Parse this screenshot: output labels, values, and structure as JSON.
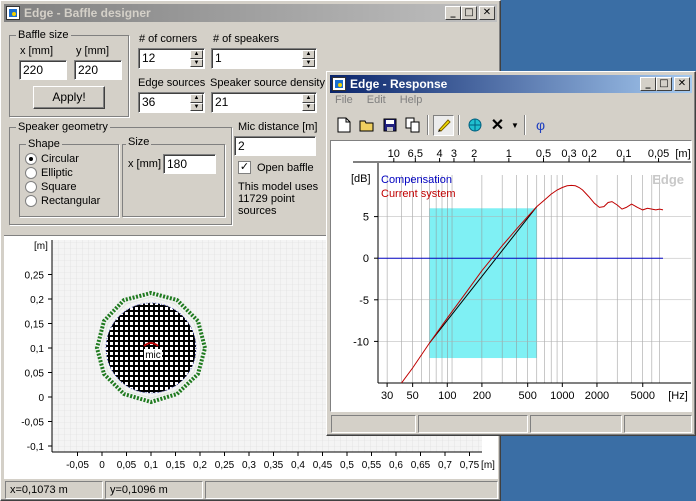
{
  "baffle_window": {
    "title": "Edge - Baffle designer",
    "baffle_size": {
      "label": "Baffle size",
      "x_label": "x [mm]",
      "y_label": "y [mm]",
      "x_value": "220",
      "y_value": "220",
      "apply_label": "Apply!"
    },
    "corners": {
      "label": "# of corners",
      "value": "12"
    },
    "speakers": {
      "label": "# of speakers",
      "value": "1"
    },
    "edge_sources": {
      "label": "Edge sources",
      "value": "36"
    },
    "density": {
      "label": "Speaker source density",
      "value": "21"
    },
    "geometry": {
      "label": "Speaker geometry",
      "shape_label": "Shape",
      "shapes": [
        "Circular",
        "Elliptic",
        "Square",
        "Rectangular"
      ],
      "selected": "Circular",
      "size_label": "Size",
      "size_x_label": "x [mm]",
      "size_x_value": "180"
    },
    "mic": {
      "label": "Mic distance [m]",
      "value": "2"
    },
    "open_baffle": {
      "label": "Open baffle",
      "checked": true
    },
    "model_info": "This model uses 11729 point sources",
    "plot": {
      "unit": "[m]",
      "y_ticks": [
        "0,25",
        "0,2",
        "0,15",
        "0,1",
        "0,05",
        "0",
        "-0,05",
        "-0,1"
      ],
      "x_ticks": [
        "-0,05",
        "0",
        "0,05",
        "0,1",
        "0,15",
        "0,2",
        "0,25",
        "0,3",
        "0,35",
        "0,4",
        "0,45",
        "0,5",
        "0,55",
        "0,6",
        "0,65",
        "0,7",
        "0,75"
      ],
      "mic_label": "mic"
    },
    "status": {
      "x": "x=0,1073 m",
      "y": "y=0,1096 m"
    }
  },
  "response_window": {
    "title": "Edge - Response",
    "menu": [
      "File",
      "Edit",
      "Help"
    ],
    "toolbar": [
      "new-icon",
      "open-icon",
      "save-icon",
      "copy-icon",
      "pen-icon",
      "globe-icon",
      "delete-icon",
      "dropdown-icon",
      "phi-icon"
    ],
    "phi_symbol": "φ",
    "chart_data": {
      "type": "line",
      "title": "",
      "ylabel": "[dB]",
      "xlabel": "[Hz]",
      "top_axis_label": "[m]",
      "watermark": "Edge",
      "ylim": [
        -15,
        10
      ],
      "xlim": [
        25,
        7500
      ],
      "x_scale": "log",
      "y_ticks": [
        "5",
        "0",
        "-5",
        "-10"
      ],
      "x_ticks": [
        "30",
        "50",
        "100",
        "200",
        "500",
        "1000",
        "2000",
        "5000"
      ],
      "top_ticks": [
        "10",
        "6,5",
        "4",
        "3",
        "2",
        "1",
        "0,5",
        "0,3",
        "0,2",
        "0,1",
        "0,05"
      ],
      "legend": [
        "Compensation",
        "Current system"
      ],
      "highlight": {
        "x": [
          70,
          600
        ],
        "y": [
          -12,
          6
        ]
      },
      "series": [
        {
          "name": "Compensation",
          "color": "#0000c0",
          "x": [
            25,
            7500
          ],
          "y": [
            0,
            0
          ]
        },
        {
          "name": "Current system",
          "color": "#c00000",
          "x": [
            40,
            50,
            70,
            100,
            150,
            200,
            300,
            400,
            500,
            600,
            700,
            800,
            900,
            1000,
            1100,
            1200,
            1300,
            1400,
            1500,
            1700,
            1900,
            2100,
            2300,
            2500,
            2700,
            3000,
            3300,
            3600,
            4000,
            4500,
            5000,
            5500,
            6000,
            6500,
            7000,
            7500
          ],
          "y": [
            -15,
            -13.2,
            -10.2,
            -7.2,
            -3.9,
            -1.5,
            1.5,
            3.5,
            5,
            6.2,
            7,
            7.7,
            8.2,
            8.5,
            8.7,
            8.75,
            8.7,
            8.5,
            8.2,
            7.4,
            6.6,
            6.1,
            6.2,
            6.7,
            6.8,
            6.4,
            5.9,
            6.1,
            6.5,
            6.1,
            5.8,
            6.0,
            5.9,
            5.8,
            5.9,
            5.8
          ]
        }
      ]
    }
  }
}
